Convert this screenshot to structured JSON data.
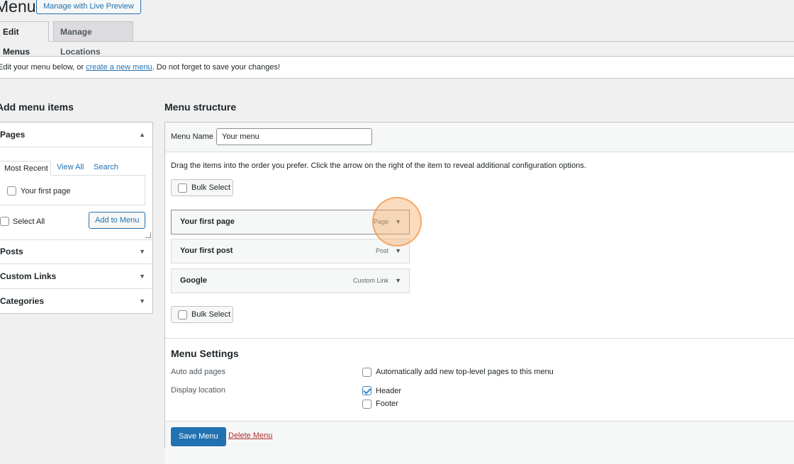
{
  "header": {
    "page_title": "Menus",
    "live_preview_label": "Manage with Live Preview"
  },
  "tabs": [
    {
      "label": "Edit Menus",
      "active": true
    },
    {
      "label": "Manage Locations",
      "active": false
    }
  ],
  "notice": {
    "before": "Edit your menu below, or ",
    "link": "create a new menu",
    "after": ". Do not forget to save your changes!"
  },
  "add_items": {
    "title": "Add menu items",
    "sections": [
      {
        "label": "Pages",
        "expanded": true
      },
      {
        "label": "Posts",
        "expanded": false
      },
      {
        "label": "Custom Links",
        "expanded": false
      },
      {
        "label": "Categories",
        "expanded": false
      }
    ],
    "pages_tabs": [
      "Most Recent",
      "View All",
      "Search"
    ],
    "pages_list": [
      {
        "label": "Your first page",
        "checked": false
      }
    ],
    "select_all_label": "Select All",
    "add_to_menu_label": "Add to Menu"
  },
  "structure": {
    "title": "Menu structure",
    "menu_name_label": "Menu Name",
    "menu_name_value": "Your menu",
    "instructions": "Drag the items into the order you prefer. Click the arrow on the right of the item to reveal additional configuration options.",
    "bulk_select_label": "Bulk Select",
    "items": [
      {
        "title": "Your first page",
        "type": "Page"
      },
      {
        "title": "Your first post",
        "type": "Post"
      },
      {
        "title": "Google",
        "type": "Custom Link"
      }
    ]
  },
  "settings": {
    "title": "Menu Settings",
    "auto_add_label": "Auto add pages",
    "auto_add_option": {
      "label": "Automatically add new top-level pages to this menu",
      "checked": false
    },
    "display_location_label": "Display location",
    "locations": [
      {
        "label": "Header",
        "checked": true
      },
      {
        "label": "Footer",
        "checked": false
      }
    ]
  },
  "footer": {
    "save_label": "Save Menu",
    "delete_label": "Delete Menu"
  },
  "colors": {
    "accent": "#2271b1",
    "delete": "#b32d2e",
    "highlight": "#f5a65a"
  }
}
